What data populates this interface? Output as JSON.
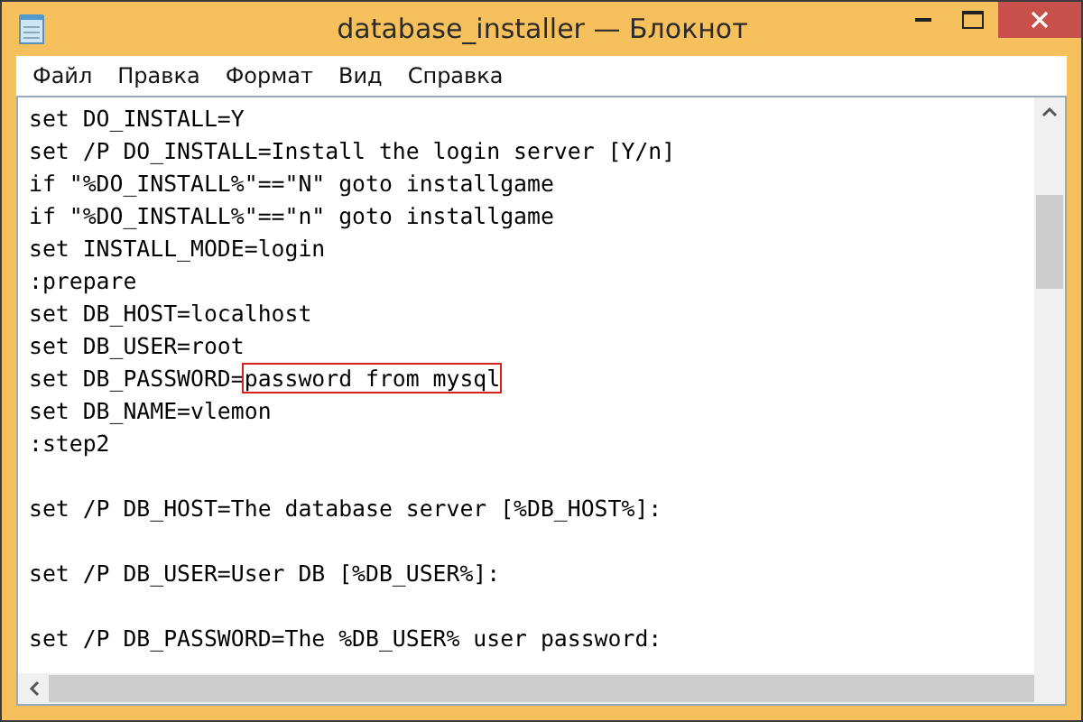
{
  "window": {
    "title": "database_installer — Блокнот"
  },
  "menu": [
    "Файл",
    "Правка",
    "Формат",
    "Вид",
    "Справка"
  ],
  "lines": [
    {
      "kind": "text",
      "text": "set DO_INSTALL=Y"
    },
    {
      "kind": "text",
      "text": "set /P DO_INSTALL=Install the login server [Y/n]"
    },
    {
      "kind": "text",
      "text": "if \"%DO_INSTALL%\"==\"N\" goto installgame"
    },
    {
      "kind": "text",
      "text": "if \"%DO_INSTALL%\"==\"n\" goto installgame"
    },
    {
      "kind": "text",
      "text": "set INSTALL_MODE=login"
    },
    {
      "kind": "text",
      "text": ":prepare"
    },
    {
      "kind": "text",
      "text": "set DB_HOST=localhost"
    },
    {
      "kind": "text",
      "text": "set DB_USER=root"
    },
    {
      "kind": "text",
      "text": "set DB_PASSWORD=",
      "boxed": "password from mysql"
    },
    {
      "kind": "text",
      "text": "set DB_NAME=vlemon"
    },
    {
      "kind": "text",
      "text": ":step2"
    },
    {
      "kind": "blank"
    },
    {
      "kind": "text",
      "text": "set /P DB_HOST=The database server [%DB_HOST%]:"
    },
    {
      "kind": "blank"
    },
    {
      "kind": "text",
      "text": "set /P DB_USER=User DB [%DB_USER%]:"
    },
    {
      "kind": "blank"
    },
    {
      "kind": "text",
      "text": "set /P DB_PASSWORD=The %DB_USER% user password:"
    }
  ]
}
